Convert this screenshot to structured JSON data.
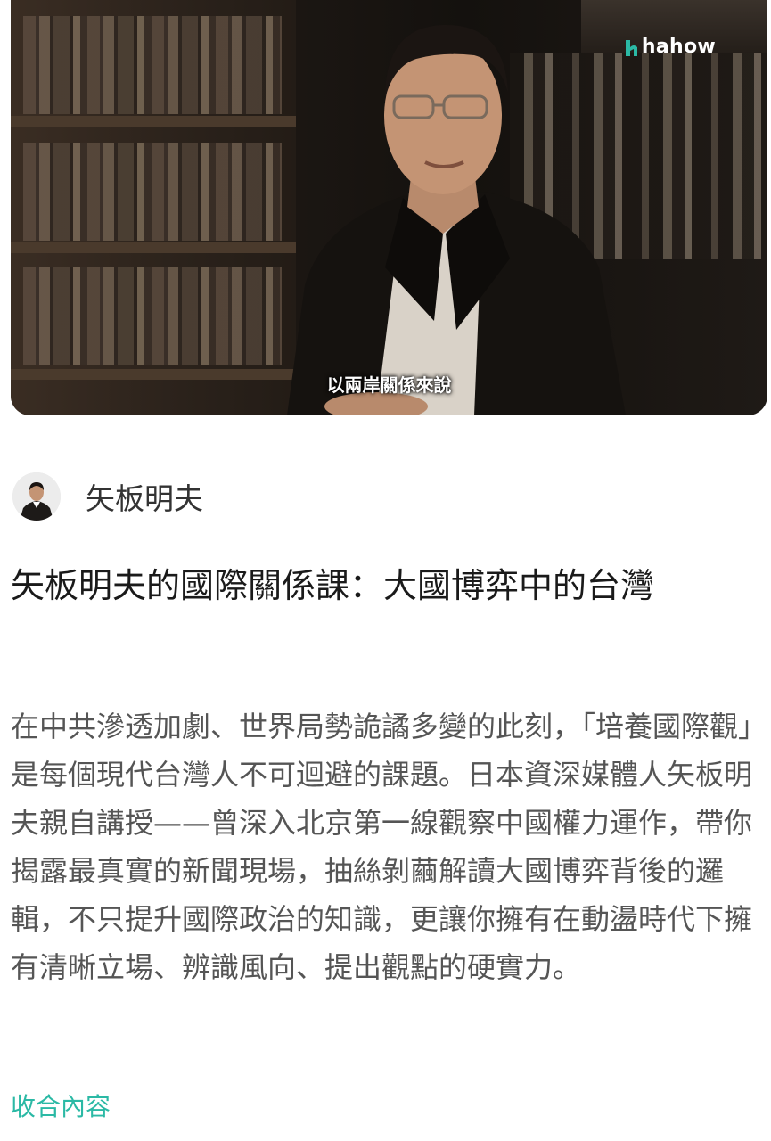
{
  "video": {
    "logo_text": "hahow",
    "subtitle": "以兩岸關係來說",
    "logo_icon": "hahow-logo-icon"
  },
  "author": {
    "name": "矢板明夫",
    "avatar_icon": "instructor-avatar"
  },
  "course": {
    "title": "矢板明夫的國際關係課：大國博弈中的台灣",
    "description": "在中共滲透加劇、世界局勢詭譎多變的此刻，「培養國際觀」是每個現代台灣人不可迴避的課題。日本資深媒體人矢板明夫親自講授——曾深入北京第一線觀察中國權力運作，帶你揭露最真實的新聞現場，抽絲剝繭解讀大國博弈背後的邏輯，不只提升國際政治的知識，更讓你擁有在動盪時代下擁有清晰立場、辨識風向、提出觀點的硬實力。",
    "collapse_label": "收合內容"
  },
  "colors": {
    "accent": "#2bb9a5",
    "title_text": "#1a1a1a",
    "body_text": "#555555"
  }
}
